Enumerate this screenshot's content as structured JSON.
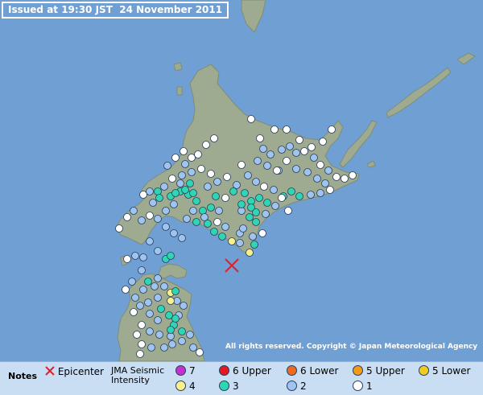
{
  "header": {
    "issued": "Issued at 19:30 JST  24 November 2011"
  },
  "copyright": "All rights reserved. Copyright © Japan Meteorological Agency",
  "legend": {
    "notes": "Notes",
    "epicenter": "Epicenter",
    "jma_line1": "JMA Seismic",
    "jma_line2": "Intensity",
    "levels": [
      {
        "label": "7",
        "color": "#c62fd2"
      },
      {
        "label": "6 Upper",
        "color": "#e6171e"
      },
      {
        "label": "6 Lower",
        "color": "#f06a1e"
      },
      {
        "label": "5 Upper",
        "color": "#f49a13"
      },
      {
        "label": "5 Lower",
        "color": "#f2cc1c"
      },
      {
        "label": "4",
        "color": "#f7f08c"
      },
      {
        "label": "3",
        "color": "#2fd6b4"
      },
      {
        "label": "2",
        "color": "#9fc4ef"
      },
      {
        "label": "1",
        "color": "#ffffff"
      }
    ]
  },
  "colors": {
    "sea": "#6f9fd3",
    "land": "#9eab91",
    "epicenter": "#e0202a"
  },
  "map": {
    "epicenter": [
      288,
      330
    ],
    "stations": [
      [
        312,
        148,
        1
      ],
      [
        323,
        172,
        1
      ],
      [
        341,
        161,
        1
      ],
      [
        356,
        161,
        1
      ],
      [
        372,
        174,
        1
      ],
      [
        387,
        183,
        1
      ],
      [
        401,
        176,
        1
      ],
      [
        412,
        161,
        1
      ],
      [
        327,
        185,
        2
      ],
      [
        336,
        192,
        2
      ],
      [
        350,
        186,
        2
      ],
      [
        360,
        182,
        2
      ],
      [
        368,
        190,
        2
      ],
      [
        378,
        188,
        1
      ],
      [
        390,
        196,
        2
      ],
      [
        398,
        205,
        1
      ],
      [
        408,
        212,
        2
      ],
      [
        418,
        220,
        1
      ],
      [
        428,
        222,
        1
      ],
      [
        438,
        218,
        1
      ],
      [
        320,
        200,
        2
      ],
      [
        332,
        206,
        2
      ],
      [
        346,
        212,
        2
      ],
      [
        356,
        200,
        1
      ],
      [
        368,
        210,
        2
      ],
      [
        382,
        214,
        2
      ],
      [
        394,
        222,
        2
      ],
      [
        404,
        228,
        2
      ],
      [
        410,
        236,
        1
      ],
      [
        300,
        205,
        1
      ],
      [
        308,
        218,
        2
      ],
      [
        318,
        226,
        2
      ],
      [
        328,
        232,
        1
      ],
      [
        340,
        236,
        2
      ],
      [
        352,
        244,
        3
      ],
      [
        362,
        238,
        3
      ],
      [
        372,
        244,
        3
      ],
      [
        386,
        242,
        2
      ],
      [
        398,
        240,
        2
      ],
      [
        294,
        230,
        2
      ],
      [
        304,
        240,
        3
      ],
      [
        312,
        250,
        3
      ],
      [
        322,
        246,
        3
      ],
      [
        332,
        252,
        3
      ],
      [
        342,
        256,
        2
      ],
      [
        350,
        246,
        1
      ],
      [
        358,
        262,
        1
      ],
      [
        300,
        262,
        2
      ],
      [
        310,
        270,
        3
      ],
      [
        318,
        276,
        3
      ],
      [
        290,
        238,
        3
      ],
      [
        280,
        246,
        1
      ],
      [
        268,
        244,
        3
      ],
      [
        258,
        232,
        2
      ],
      [
        270,
        226,
        2
      ],
      [
        282,
        220,
        1
      ],
      [
        262,
        216,
        1
      ],
      [
        250,
        210,
        1
      ],
      [
        238,
        214,
        2
      ],
      [
        226,
        218,
        2
      ],
      [
        214,
        222,
        1
      ],
      [
        204,
        232,
        2
      ],
      [
        196,
        238,
        3
      ],
      [
        186,
        238,
        2
      ],
      [
        178,
        242,
        1
      ],
      [
        224,
        238,
        3
      ],
      [
        234,
        242,
        3
      ],
      [
        244,
        250,
        3
      ],
      [
        252,
        262,
        3
      ],
      [
        262,
        258,
        3
      ],
      [
        272,
        262,
        2
      ],
      [
        240,
        262,
        2
      ],
      [
        232,
        272,
        2
      ],
      [
        244,
        276,
        3
      ],
      [
        254,
        270,
        2
      ],
      [
        266,
        288,
        3
      ],
      [
        276,
        294,
        3
      ],
      [
        288,
        300,
        4
      ],
      [
        298,
        302,
        2
      ],
      [
        310,
        314,
        4
      ],
      [
        314,
        294,
        2
      ],
      [
        316,
        304,
        3
      ],
      [
        298,
        290,
        2
      ],
      [
        280,
        282,
        2
      ],
      [
        270,
        276,
        1
      ],
      [
        228,
        188,
        1
      ],
      [
        238,
        196,
        1
      ],
      [
        218,
        196,
        1
      ],
      [
        208,
        206,
        2
      ],
      [
        230,
        204,
        2
      ],
      [
        246,
        192,
        1
      ],
      [
        256,
        180,
        1
      ],
      [
        266,
        172,
        1
      ],
      [
        302,
        284,
        2
      ],
      [
        326,
        290,
        1
      ],
      [
        216,
        254,
        2
      ],
      [
        206,
        262,
        2
      ],
      [
        196,
        272,
        2
      ],
      [
        186,
        268,
        1
      ],
      [
        176,
        274,
        2
      ],
      [
        166,
        262,
        2
      ],
      [
        158,
        270,
        1
      ],
      [
        148,
        284,
        1
      ],
      [
        206,
        282,
        2
      ],
      [
        216,
        290,
        2
      ],
      [
        226,
        296,
        2
      ],
      [
        186,
        300,
        2
      ],
      [
        196,
        312,
        2
      ],
      [
        206,
        322,
        3
      ],
      [
        212,
        318,
        3
      ],
      [
        178,
        320,
        2
      ],
      [
        168,
        318,
        2
      ],
      [
        158,
        322,
        1
      ],
      [
        176,
        336,
        2
      ],
      [
        184,
        350,
        3
      ],
      [
        196,
        346,
        2
      ],
      [
        204,
        356,
        2
      ],
      [
        212,
        364,
        4
      ],
      [
        196,
        370,
        2
      ],
      [
        184,
        376,
        2
      ],
      [
        174,
        380,
        2
      ],
      [
        166,
        388,
        1
      ],
      [
        186,
        390,
        2
      ],
      [
        200,
        384,
        3
      ],
      [
        210,
        392,
        3
      ],
      [
        222,
        392,
        2
      ],
      [
        216,
        404,
        3
      ],
      [
        226,
        412,
        3
      ],
      [
        236,
        416,
        2
      ],
      [
        212,
        418,
        2
      ],
      [
        198,
        416,
        2
      ],
      [
        186,
        412,
        2
      ],
      [
        176,
        404,
        1
      ],
      [
        170,
        416,
        1
      ],
      [
        176,
        428,
        1
      ],
      [
        188,
        432,
        2
      ],
      [
        204,
        432,
        2
      ],
      [
        214,
        428,
        2
      ],
      [
        226,
        424,
        2
      ],
      [
        240,
        432,
        2
      ],
      [
        248,
        438,
        1
      ],
      [
        174,
        440,
        1
      ],
      [
        164,
        350,
        2
      ],
      [
        156,
        360,
        1
      ],
      [
        168,
        370,
        2
      ],
      [
        178,
        360,
        2
      ],
      [
        192,
        356,
        2
      ],
      [
        218,
        362,
        3
      ],
      [
        228,
        380,
        2
      ],
      [
        220,
        374,
        2
      ],
      [
        344,
        212,
        1
      ],
      [
        258,
        278,
        3
      ],
      [
        190,
        252,
        2
      ],
      [
        198,
        246,
        3
      ],
      [
        236,
        228,
        3
      ],
      [
        224,
        228,
        2
      ],
      [
        212,
        244,
        3
      ],
      [
        218,
        240,
        3
      ],
      [
        230,
        236,
        3
      ],
      [
        240,
        240,
        3
      ],
      [
        300,
        254,
        3
      ],
      [
        312,
        258,
        3
      ],
      [
        318,
        264,
        3
      ],
      [
        330,
        266,
        2
      ],
      [
        212,
        374,
        4
      ],
      [
        212,
        410,
        3
      ],
      [
        218,
        396,
        3
      ],
      [
        196,
        398,
        2
      ]
    ]
  }
}
